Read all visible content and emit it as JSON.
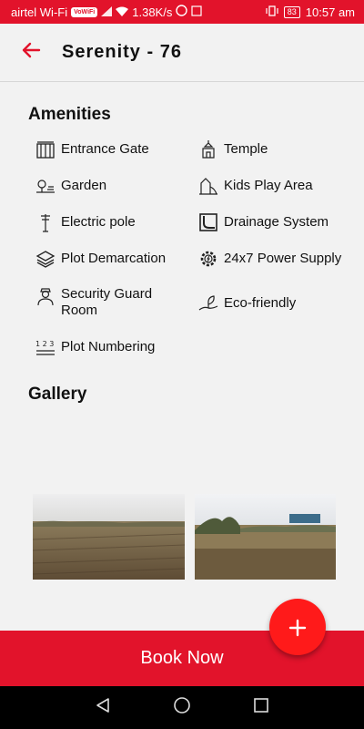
{
  "status": {
    "carrier": "airtel Wi-Fi",
    "wifi_badge": "VoWiFi",
    "speed": "1.38K/s",
    "battery": "83",
    "time": "10:57 am"
  },
  "header": {
    "title": "Serenity - 76"
  },
  "amenities": {
    "title": "Amenities",
    "items": [
      {
        "label": "Entrance Gate",
        "icon": "gate-icon"
      },
      {
        "label": "Temple",
        "icon": "temple-icon"
      },
      {
        "label": "Garden",
        "icon": "garden-icon"
      },
      {
        "label": "Kids Play Area",
        "icon": "playground-icon"
      },
      {
        "label": "Electric pole",
        "icon": "electric-pole-icon"
      },
      {
        "label": "Drainage System",
        "icon": "drainage-icon"
      },
      {
        "label": "Plot Demarcation",
        "icon": "layers-icon"
      },
      {
        "label": "24x7 Power Supply",
        "icon": "power-gear-icon"
      },
      {
        "label": "Security Guard Room",
        "icon": "guard-icon"
      },
      {
        "label": "Eco-friendly",
        "icon": "eco-leaf-icon"
      },
      {
        "label": "Plot Numbering",
        "icon": "numbering-icon"
      }
    ]
  },
  "gallery": {
    "title": "Gallery"
  },
  "book_button": {
    "label": "Book Now"
  },
  "fab": {
    "label": "+"
  },
  "colors": {
    "brand": "#e2132b",
    "fab": "#ff1a1a"
  }
}
